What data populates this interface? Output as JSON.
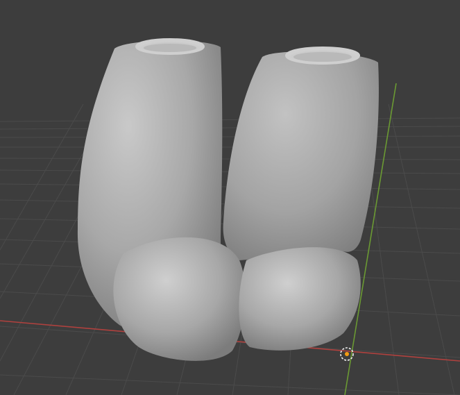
{
  "app": {
    "name": "",
    "view": "3D Viewport"
  },
  "scene": {
    "background_color": "#3d3d3d",
    "grid_color": "#4a4a4a",
    "axis_x_color": "#b0413e",
    "axis_y_color": "#6b9a33",
    "object": {
      "type": "mesh",
      "shading": "solid",
      "color": "#a9a9a9",
      "description_visible": false
    },
    "origin_marker": {
      "icon": "3d-cursor-icon",
      "color": "#f39c12"
    }
  }
}
